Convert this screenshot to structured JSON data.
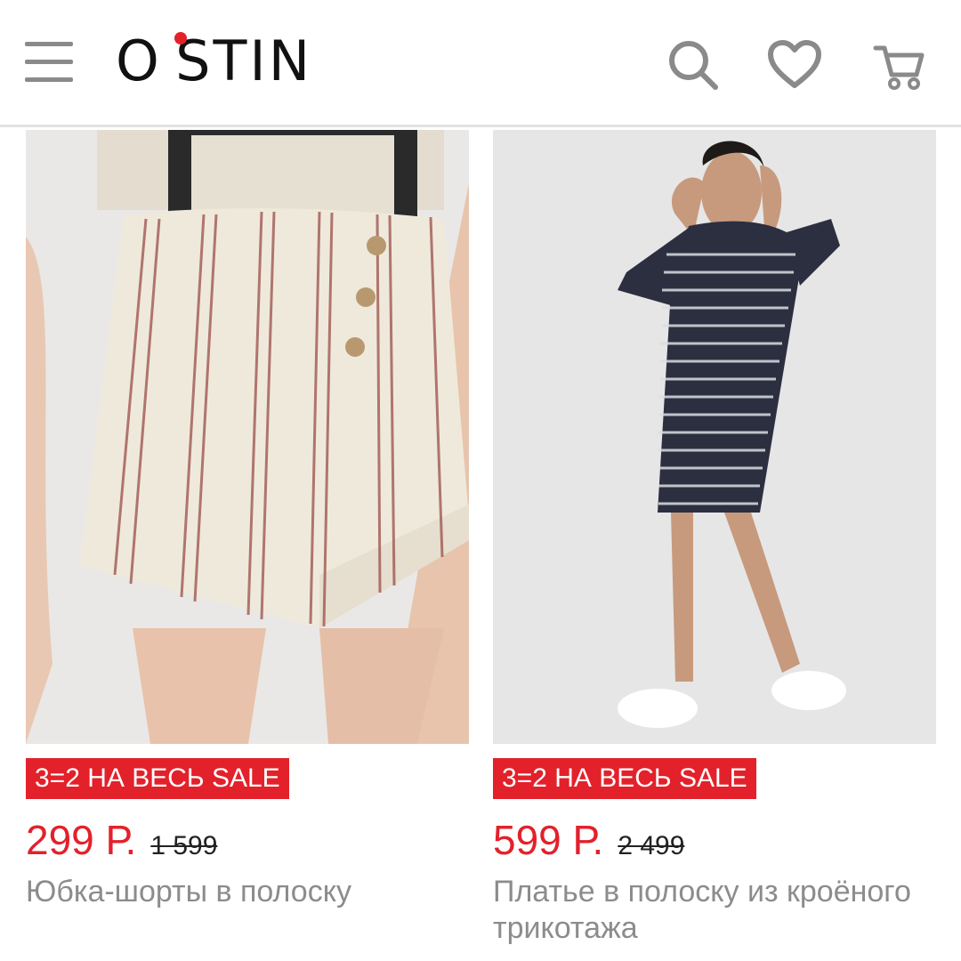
{
  "header": {
    "logo": "O'STIN",
    "icons": [
      "menu-icon",
      "search-icon",
      "heart-icon",
      "cart-icon"
    ]
  },
  "products": [
    {
      "badge": "3=2 НА ВЕСЬ SALE",
      "price": "299 Р.",
      "old_price": "1 599",
      "title": "Юбка-шорты в полоску"
    },
    {
      "badge": "3=2 НА ВЕСЬ SALE",
      "price": "599 Р.",
      "old_price": "2 499",
      "title": "Платье в полоску из кроёного трикотажа"
    }
  ],
  "colors": {
    "accent": "#e3212b",
    "icon_gray": "#8a8a8a",
    "title_gray": "#8c8c8c"
  }
}
